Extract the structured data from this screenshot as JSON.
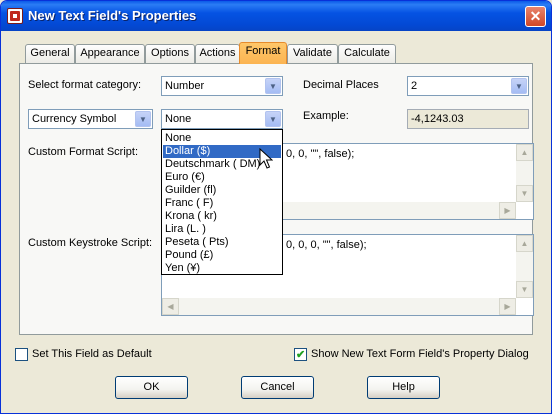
{
  "window": {
    "title": "New Text Field's Properties",
    "close_glyph": "✕"
  },
  "tabs": [
    {
      "label": "General"
    },
    {
      "label": "Appearance"
    },
    {
      "label": "Options"
    },
    {
      "label": "Actions"
    },
    {
      "label": "Format",
      "active": true
    },
    {
      "label": "Validate"
    },
    {
      "label": "Calculate"
    }
  ],
  "format": {
    "category_label": "Select format category:",
    "category_value": "Number",
    "decimal_label": "Decimal Places",
    "decimal_value": "2",
    "currency_select_value": "Currency Symbol",
    "currency_value": "None",
    "example_label": "Example:",
    "example_value": "-4,1243.03",
    "custom_format_label": "Custom Format Script:",
    "custom_format_text": "0, 0, \"\", false);",
    "custom_keystroke_label": "Custom Keystroke Script:",
    "custom_keystroke_text": "0, 0, 0, \"\", false);"
  },
  "currency_options": [
    "None",
    "Dollar ($)",
    "Deutschmark ( DM)",
    "Euro (€)",
    "Guilder (fl)",
    "Franc ( F)",
    "Krona ( kr)",
    "Lira (L. )",
    "Peseta ( Pts)",
    "Pound (£)",
    "Yen (¥)"
  ],
  "highlighted_option": "Dollar ($)",
  "checkboxes": {
    "default_label": "Set This Field as Default",
    "default_checked": false,
    "show_dialog_label": "Show New Text Form Field's Property Dialog",
    "show_dialog_checked": true
  },
  "buttons": {
    "ok": "OK",
    "cancel": "Cancel",
    "help": "Help"
  },
  "icons": {
    "dropdown_arrow": "▼",
    "scroll_up": "▲",
    "scroll_down": "▼",
    "scroll_left": "◀",
    "scroll_right": "▶",
    "check": "✔"
  }
}
